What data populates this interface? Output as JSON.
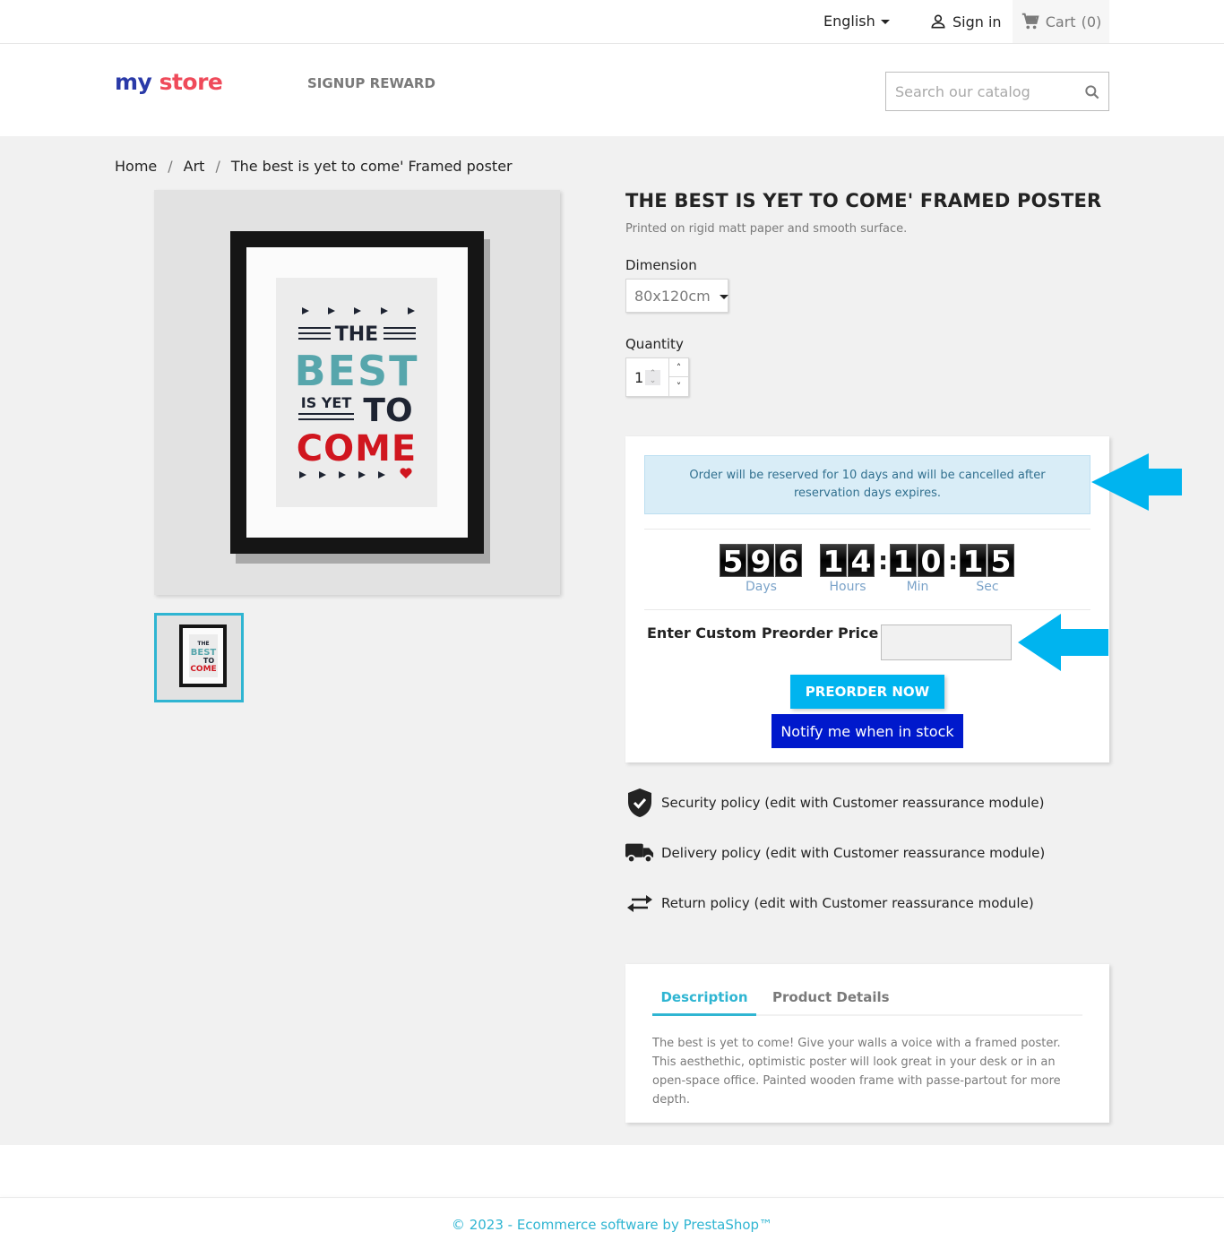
{
  "topnav": {
    "language": "English",
    "signin_label": "Sign in",
    "cart_label": "Cart",
    "cart_count": "(0)"
  },
  "header": {
    "logo_text_my": "my",
    "logo_text_store": "store",
    "menu_item": "SIGNUP REWARD",
    "search_placeholder": "Search our catalog"
  },
  "breadcrumb": {
    "items": [
      "Home",
      "Art",
      "The best is yet to come' Framed poster"
    ],
    "separator": "/"
  },
  "product": {
    "title": "THE BEST IS YET TO COME' FRAMED POSTER",
    "summary": "Printed on rigid matt paper and smooth surface.",
    "dimension_label": "Dimension",
    "dimension_value": "80x120cm",
    "quantity_label": "Quantity",
    "quantity_value": "1",
    "poster_text": {
      "line1": "THE",
      "line2": "BEST",
      "line3a": "IS YET",
      "line3b": "TO",
      "line4": "COME"
    }
  },
  "preorder": {
    "alert": "Order will be reserved for 10 days and will be cancelled after reservation days expires.",
    "countdown": {
      "days": [
        "5",
        "9",
        "6"
      ],
      "hours": [
        "1",
        "4"
      ],
      "minutes": [
        "1",
        "0"
      ],
      "seconds": [
        "1",
        "5"
      ],
      "labels": {
        "days": "Days",
        "hours": "Hours",
        "minutes": "Min",
        "seconds": "Sec"
      }
    },
    "custom_price_label": "Enter Custom Preorder Price",
    "custom_price_value": "",
    "preorder_button": "PREORDER NOW",
    "notify_button": "Notify me when in stock"
  },
  "reassurance": [
    {
      "icon": "shield-check-icon",
      "text": "Security policy (edit with Customer reassurance module)"
    },
    {
      "icon": "truck-icon",
      "text": "Delivery policy (edit with Customer reassurance module)"
    },
    {
      "icon": "swap-arrows-icon",
      "text": "Return policy (edit with Customer reassurance module)"
    }
  ],
  "tabs": {
    "items": [
      "Description",
      "Product Details"
    ],
    "active": "Description",
    "description": "The best is yet to come! Give your walls a voice with a framed poster. This aesthethic, optimistic poster will look great in your desk or in an open-space office. Painted wooden frame with passe-partout for more depth."
  },
  "footer": {
    "copyright": "© 2023 - Ecommerce software by PrestaShop™"
  },
  "colors": {
    "accent": "#2fb5d2",
    "preorder_button": "#00b4ef",
    "notify_button": "#0019cc",
    "annotation_arrow": "#00b4ef",
    "alert_bg": "#d9edf7",
    "alert_text": "#31708f"
  }
}
